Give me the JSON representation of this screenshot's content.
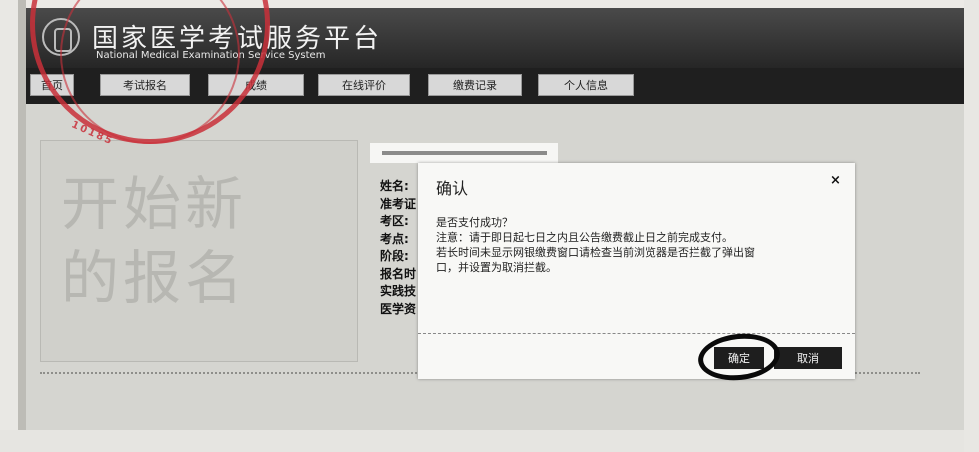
{
  "header": {
    "title": "国家医学考试服务平台",
    "subtitle": "National Medical Examination Service System"
  },
  "nav": {
    "items": [
      {
        "label": "首页"
      },
      {
        "label": "考试报名"
      },
      {
        "label": "成绩"
      },
      {
        "label": "在线评价"
      },
      {
        "label": "缴费记录"
      },
      {
        "label": "个人信息"
      }
    ]
  },
  "banner": {
    "line1": "开始新",
    "line2": "的报名"
  },
  "info_labels": [
    "姓名:",
    "准考证",
    "考区:",
    "考点:",
    "阶段:",
    "报名时",
    "实践技",
    "医学资"
  ],
  "dialog": {
    "title": "确认",
    "close_icon": "×",
    "question": "是否支付成功？",
    "note_line1": "注意：请于即日起七日之内且公告缴费截止日之前完成支付。",
    "note_line2": "若长时间未显示网银缴费窗口请检查当前浏览器是否拦截了弹出窗",
    "note_line3": "口，并设置为取消拦截。",
    "ok_label": "确定",
    "cancel_label": "取消"
  },
  "stamp_text": "10185"
}
